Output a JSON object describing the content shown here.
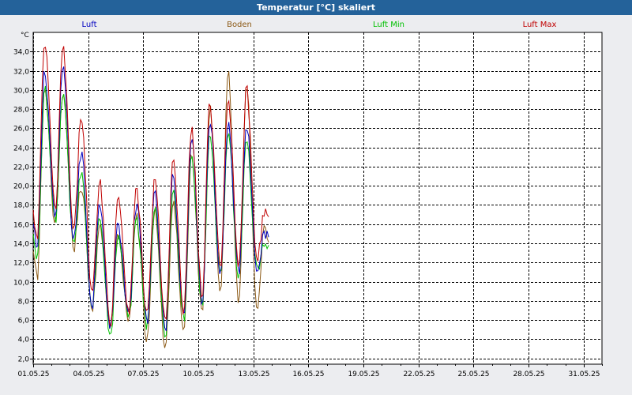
{
  "window": {
    "title": "Temperatur [°C] skaliert"
  },
  "chart_data": {
    "type": "line",
    "title": "Temperatur [°C] skaliert",
    "ylabel": "°C",
    "xlabel": "",
    "ylim": [
      1.4,
      36.0
    ],
    "xlim": [
      "2025-05-01",
      "2025-06-01"
    ],
    "y_ticks": [
      2.0,
      4.0,
      6.0,
      8.0,
      10.0,
      12.0,
      14.0,
      16.0,
      18.0,
      20.0,
      22.0,
      24.0,
      26.0,
      28.0,
      30.0,
      32.0,
      34.0
    ],
    "y_tick_labels": [
      "2,0",
      "4,0",
      "6,0",
      "8,0",
      "10,0",
      "12,0",
      "14,0",
      "16,0",
      "18,0",
      "20,0",
      "22,0",
      "24,0",
      "26,0",
      "28,0",
      "30,0",
      "32,0",
      "34,0"
    ],
    "x_ticks": [
      "2025-05-01",
      "2025-05-04",
      "2025-05-07",
      "2025-05-10",
      "2025-05-13",
      "2025-05-16",
      "2025-05-19",
      "2025-05-22",
      "2025-05-25",
      "2025-05-28",
      "2025-05-31"
    ],
    "x_tick_labels": [
      "01.05.25",
      "04.05.25",
      "07.05.25",
      "10.05.25",
      "13.05.25",
      "16.05.25",
      "19.05.25",
      "22.05.25",
      "25.05.25",
      "28.05.25",
      "31.05.25"
    ],
    "grid": true,
    "legend_position": "top",
    "series": [
      {
        "name": "Luft",
        "color": "#0000c0",
        "x": [
          "2025-05-01",
          "2025-05-02",
          "2025-05-03",
          "2025-05-04",
          "2025-05-05",
          "2025-05-06",
          "2025-05-07",
          "2025-05-08",
          "2025-05-09",
          "2025-05-10",
          "2025-05-11",
          "2025-05-12",
          "2025-05-13"
        ],
        "min": [
          13.0,
          16.8,
          14.5,
          7.5,
          5.0,
          6.5,
          6.0,
          4.8,
          6.5,
          8.0,
          11.0,
          11.0,
          11.5
        ],
        "max": [
          32.0,
          32.5,
          23.5,
          18.5,
          16.0,
          18.0,
          19.0,
          21.0,
          25.0,
          27.0,
          26.5,
          26.5,
          15.0
        ]
      },
      {
        "name": "Boden",
        "color": "#8c5a16",
        "x": [
          "2025-05-01",
          "2025-05-02",
          "2025-05-03",
          "2025-05-04",
          "2025-05-05",
          "2025-05-06",
          "2025-05-07",
          "2025-05-08",
          "2025-05-09",
          "2025-05-10",
          "2025-05-11",
          "2025-05-12",
          "2025-05-13"
        ],
        "min": [
          10.0,
          16.0,
          13.5,
          7.0,
          5.5,
          5.5,
          3.8,
          3.0,
          4.5,
          7.0,
          9.5,
          7.5,
          7.0
        ],
        "max": [
          30.0,
          29.5,
          20.0,
          16.0,
          15.0,
          17.0,
          17.5,
          18.5,
          23.0,
          28.0,
          32.0,
          30.5,
          16.0
        ]
      },
      {
        "name": "Luft Min",
        "color": "#00c000",
        "x": [
          "2025-05-01",
          "2025-05-02",
          "2025-05-03",
          "2025-05-04",
          "2025-05-05",
          "2025-05-06",
          "2025-05-07",
          "2025-05-08",
          "2025-05-09",
          "2025-05-10",
          "2025-05-11",
          "2025-05-12",
          "2025-05-13"
        ],
        "min": [
          12.0,
          16.5,
          14.0,
          7.0,
          4.0,
          6.0,
          5.5,
          4.5,
          6.0,
          7.5,
          10.5,
          10.5,
          11.0
        ],
        "max": [
          30.0,
          29.5,
          21.5,
          17.0,
          14.5,
          16.5,
          17.5,
          19.5,
          23.0,
          25.0,
          25.5,
          24.5,
          14.0
        ]
      },
      {
        "name": "Luft Max",
        "color": "#c00000",
        "x": [
          "2025-05-01",
          "2025-05-02",
          "2025-05-03",
          "2025-05-04",
          "2025-05-05",
          "2025-05-06",
          "2025-05-07",
          "2025-05-08",
          "2025-05-09",
          "2025-05-10",
          "2025-05-11",
          "2025-05-12",
          "2025-05-13"
        ],
        "min": [
          14.0,
          17.5,
          15.0,
          8.5,
          5.5,
          7.0,
          6.5,
          5.5,
          7.0,
          8.5,
          11.5,
          12.0,
          12.5
        ],
        "max": [
          35.0,
          34.5,
          27.5,
          20.5,
          19.0,
          19.5,
          20.5,
          22.5,
          26.0,
          28.5,
          29.0,
          30.0,
          17.5
        ]
      }
    ]
  }
}
